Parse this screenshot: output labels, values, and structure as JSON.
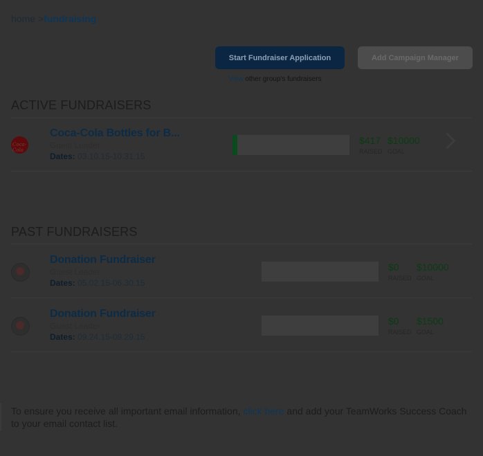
{
  "breadcrumb": {
    "home": "home",
    "separator": ">",
    "current": "fundraising"
  },
  "actions": {
    "start_label": "Start Fundraiser Application",
    "add_manager_label": "Add Campaign Manager",
    "view_link": "View",
    "view_rest": "other group's fundraisers"
  },
  "active": {
    "title": "ACTIVE FUNDRAISERS",
    "items": [
      {
        "logo": "Coca-Cola",
        "name": "Coca-Cola Bottles for B...",
        "leader": "Guest Leader",
        "dates_label": "Dates:",
        "dates": "03.10.15-10.31.15",
        "raised": "$417",
        "goal": "$10000",
        "raised_label": "RAISED",
        "goal_label": "GOAL",
        "progress": 0.0417
      }
    ]
  },
  "past": {
    "title": "PAST FUNDRAISERS",
    "items": [
      {
        "name": "Donation Fundraiser",
        "leader": "Guest Leader",
        "dates_label": "Dates:",
        "dates": "05.02.15-06.30.15",
        "raised": "$0",
        "goal": "$10000",
        "raised_label": "RAISED",
        "goal_label": "GOAL",
        "progress": 0
      },
      {
        "name": "Donation Fundraiser",
        "leader": "Guest Leader",
        "dates_label": "Dates:",
        "dates": "09.24.15-09.29.15",
        "raised": "$0",
        "goal": "$1500",
        "raised_label": "RAISED",
        "goal_label": "GOAL",
        "progress": 0
      }
    ]
  },
  "footer": {
    "text_before": "To ensure you receive all important email information,",
    "link": "click here",
    "text_after": "and add your TeamWorks Success Coach to your email contact list."
  },
  "colors": {
    "overlay": "#333333",
    "primary": "#0a2642",
    "money": "#0b3a14",
    "progress_fill": "#0a4a1e"
  }
}
